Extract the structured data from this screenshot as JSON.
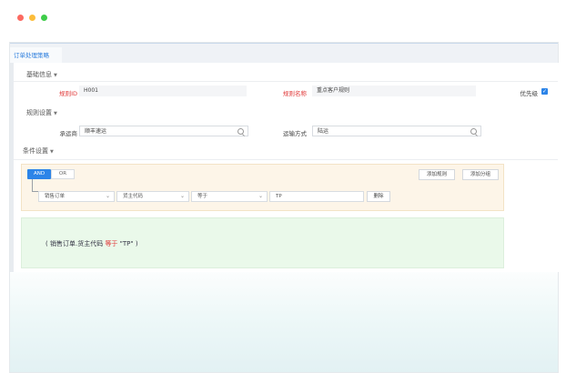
{
  "window": {
    "controls": [
      "close",
      "minimize",
      "maximize"
    ]
  },
  "tabs": [
    {
      "label": "订单处理策略"
    }
  ],
  "sections": {
    "basic": {
      "title": "基础信息"
    },
    "rules": {
      "title": "规则设置"
    },
    "conditions": {
      "title": "条件设置"
    }
  },
  "basic_fields": {
    "rule_id_label": "规则ID",
    "rule_id_value": "H001",
    "rule_name_label": "规则名称",
    "rule_name_value": "重点客户规则",
    "priority_label": "优先级",
    "priority_checked": true
  },
  "rule_fields": {
    "carrier_label": "承运商",
    "carrier_value": "顺丰速运",
    "transport_label": "运输方式",
    "transport_value": "陆运"
  },
  "condition_builder": {
    "and_label": "AND",
    "or_label": "OR",
    "add_rule_label": "添加规则",
    "add_group_label": "添加分组",
    "row": {
      "field_group": "销售订单",
      "field_name": "货主代码",
      "operator": "等于",
      "value": "TP",
      "delete_label": "删除"
    }
  },
  "result": {
    "open": "(",
    "field": "销售订单.货主代码",
    "operator": "等于",
    "value": "\"TP\"",
    "close": ")"
  },
  "colors": {
    "accent": "#2c84e8",
    "required": "#e03838",
    "condition_bg": "#fdf5e8",
    "result_bg": "#eaf9ea"
  }
}
